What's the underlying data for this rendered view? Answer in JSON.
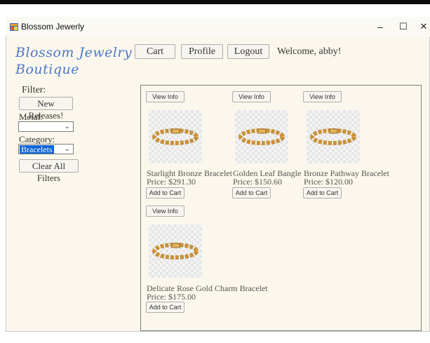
{
  "window": {
    "title": "Blossom Jewerly",
    "controls": {
      "minimize": "–",
      "maximize": "☐",
      "close": "✕"
    }
  },
  "logo": {
    "line1": "Blossom Jewelry",
    "line2": "Boutique"
  },
  "nav": {
    "cart": "Cart",
    "profile": "Profile",
    "logout": "Logout",
    "welcome": "Welcome, abby!"
  },
  "filters": {
    "title": "Filter:",
    "new_releases": "New Releases!",
    "metal_label": "Metal:",
    "metal_value": "",
    "category_label": "Category:",
    "category_value": "Bracelets",
    "clear": "Clear All Filters"
  },
  "products": [
    {
      "name": "Starlight Bronze Bracelet",
      "price": "Price: $291.30",
      "view": "View Info",
      "add": "Add to Cart"
    },
    {
      "name": "Golden Leaf Bangle",
      "price": "Price: $150.60",
      "view": "View Info",
      "add": "Add to Cart"
    },
    {
      "name": "Bronze Pathway Bracelet",
      "price": "Price: $120.00",
      "view": "View Info",
      "add": "Add to Cart"
    },
    {
      "name": "Delicate Rose Gold Charm Bracelet",
      "price": "Price: $175.00",
      "view": "View Info",
      "add": "Add to Cart"
    }
  ],
  "colors": {
    "logo": "#4d79c9",
    "background": "#fbf7ec",
    "selection": "#0a64d6",
    "gold": "#c8913a"
  }
}
